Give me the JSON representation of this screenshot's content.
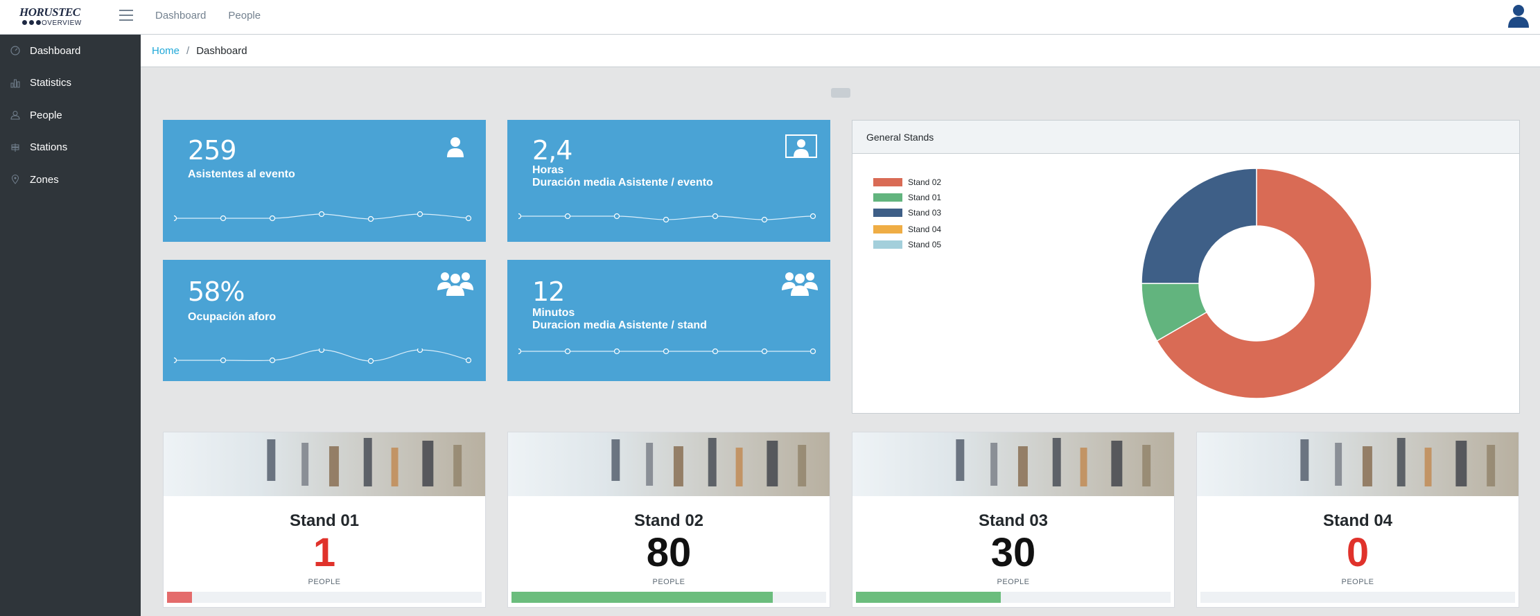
{
  "app": {
    "logo_brand": "HORUSTEC",
    "logo_sub": "OVERVIEW",
    "top_nav": [
      "Dashboard",
      "People"
    ]
  },
  "sidebar": {
    "items": [
      {
        "label": "Dashboard",
        "icon": "speedometer-icon"
      },
      {
        "label": "Statistics",
        "icon": "bar-chart-icon"
      },
      {
        "label": "People",
        "icon": "user-icon"
      },
      {
        "label": "Stations",
        "icon": "signpost-icon"
      },
      {
        "label": "Zones",
        "icon": "location-pin-icon"
      }
    ]
  },
  "breadcrumb": {
    "home": "Home",
    "separator": "/",
    "current": "Dashboard"
  },
  "kpis": [
    {
      "value": "259",
      "label": "Asistentes al evento",
      "label2": "",
      "icon": "user-icon"
    },
    {
      "value": "2,4",
      "label": "Horas",
      "label2": "Duración media Asistente / evento",
      "icon": "user-portrait-icon"
    },
    {
      "value": "58%",
      "label": "Ocupación aforo",
      "label2": "",
      "icon": "users-group-icon"
    },
    {
      "value": "12",
      "label": "Minutos",
      "label2": "Duracion media Asistente / stand",
      "icon": "users-group-icon"
    }
  ],
  "general_stands": {
    "title": "General Stands",
    "legend": [
      {
        "name": "Stand 02",
        "color": "#d96b55"
      },
      {
        "name": "Stand 01",
        "color": "#62b47e"
      },
      {
        "name": "Stand 03",
        "color": "#3e5f87"
      },
      {
        "name": "Stand 04",
        "color": "#efad45"
      },
      {
        "name": "Stand 05",
        "color": "#a3cfdb"
      }
    ]
  },
  "chart_data": {
    "type": "pie",
    "title": "General Stands",
    "categories": [
      "Stand 02",
      "Stand 01",
      "Stand 03",
      "Stand 04",
      "Stand 05"
    ],
    "values": [
      80,
      1,
      30,
      0,
      0
    ],
    "donut": true,
    "legend_position": "left"
  },
  "stands": [
    {
      "name": "Stand 01",
      "count": "1",
      "unit": "PEOPLE",
      "count_color": "#e0322b",
      "progress": 0.08,
      "bar_color": "#e46b6b"
    },
    {
      "name": "Stand 02",
      "count": "80",
      "unit": "PEOPLE",
      "count_color": "#111111",
      "progress": 0.83,
      "bar_color": "#6bbd7d"
    },
    {
      "name": "Stand 03",
      "count": "30",
      "unit": "PEOPLE",
      "count_color": "#111111",
      "progress": 0.46,
      "bar_color": "#6bbd7d"
    },
    {
      "name": "Stand 04",
      "count": "0",
      "unit": "PEOPLE",
      "count_color": "#e0322b",
      "progress": 0,
      "bar_color": "#6bbd7d"
    }
  ]
}
